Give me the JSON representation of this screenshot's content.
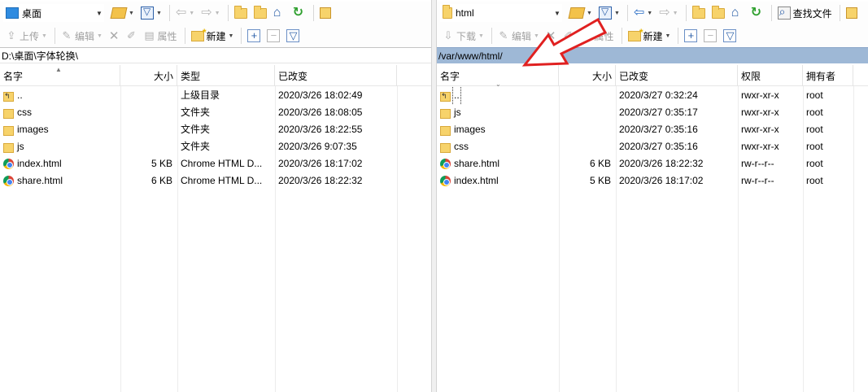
{
  "left": {
    "location_combo": "桌面",
    "toolbar2": {
      "upload": "上传",
      "edit": "编辑",
      "properties": "属性",
      "new": "新建"
    },
    "path": "D:\\桌面\\字体轮换\\",
    "columns": {
      "name": "名字",
      "size": "大小",
      "type": "类型",
      "modified": "已改变"
    },
    "rows": [
      {
        "name": "..",
        "size": "",
        "type": "上级目录",
        "modified": "2020/3/26   18:02:49",
        "icon": "parent-folder-icon"
      },
      {
        "name": "css",
        "size": "",
        "type": "文件夹",
        "modified": "2020/3/26   18:08:05",
        "icon": "folder-icon"
      },
      {
        "name": "images",
        "size": "",
        "type": "文件夹",
        "modified": "2020/3/26   18:22:55",
        "icon": "folder-icon"
      },
      {
        "name": "js",
        "size": "",
        "type": "文件夹",
        "modified": "2020/3/26   9:07:35",
        "icon": "folder-icon"
      },
      {
        "name": "index.html",
        "size": "5 KB",
        "type": "Chrome HTML D...",
        "modified": "2020/3/26   18:17:02",
        "icon": "chrome-html-icon"
      },
      {
        "name": "share.html",
        "size": "6 KB",
        "type": "Chrome HTML D...",
        "modified": "2020/3/26   18:22:32",
        "icon": "chrome-html-icon"
      }
    ]
  },
  "right": {
    "location_combo": "html",
    "find_files": "查找文件",
    "toolbar2": {
      "download": "下载",
      "edit": "编辑",
      "properties": "属性",
      "new": "新建"
    },
    "path": "/var/www/html/",
    "columns": {
      "name": "名字",
      "size": "大小",
      "modified": "已改变",
      "permissions": "权限",
      "owner": "拥有者"
    },
    "rows": [
      {
        "name": "..",
        "size": "",
        "modified": "2020/3/27 0:32:24",
        "permissions": "rwxr-xr-x",
        "owner": "root",
        "icon": "parent-folder-icon"
      },
      {
        "name": "js",
        "size": "",
        "modified": "2020/3/27 0:35:17",
        "permissions": "rwxr-xr-x",
        "owner": "root",
        "icon": "folder-icon"
      },
      {
        "name": "images",
        "size": "",
        "modified": "2020/3/27 0:35:16",
        "permissions": "rwxr-xr-x",
        "owner": "root",
        "icon": "folder-icon"
      },
      {
        "name": "css",
        "size": "",
        "modified": "2020/3/27 0:35:16",
        "permissions": "rwxr-xr-x",
        "owner": "root",
        "icon": "folder-icon"
      },
      {
        "name": "share.html",
        "size": "6 KB",
        "modified": "2020/3/26 18:22:32",
        "permissions": "rw-r--r--",
        "owner": "root",
        "icon": "chrome-html-icon"
      },
      {
        "name": "index.html",
        "size": "5 KB",
        "modified": "2020/3/26 18:17:02",
        "permissions": "rw-r--r--",
        "owner": "root",
        "icon": "chrome-html-icon"
      }
    ]
  },
  "annotation": {
    "arrow_color": "#e02020",
    "icon": "red-annotation-arrow-icon"
  }
}
